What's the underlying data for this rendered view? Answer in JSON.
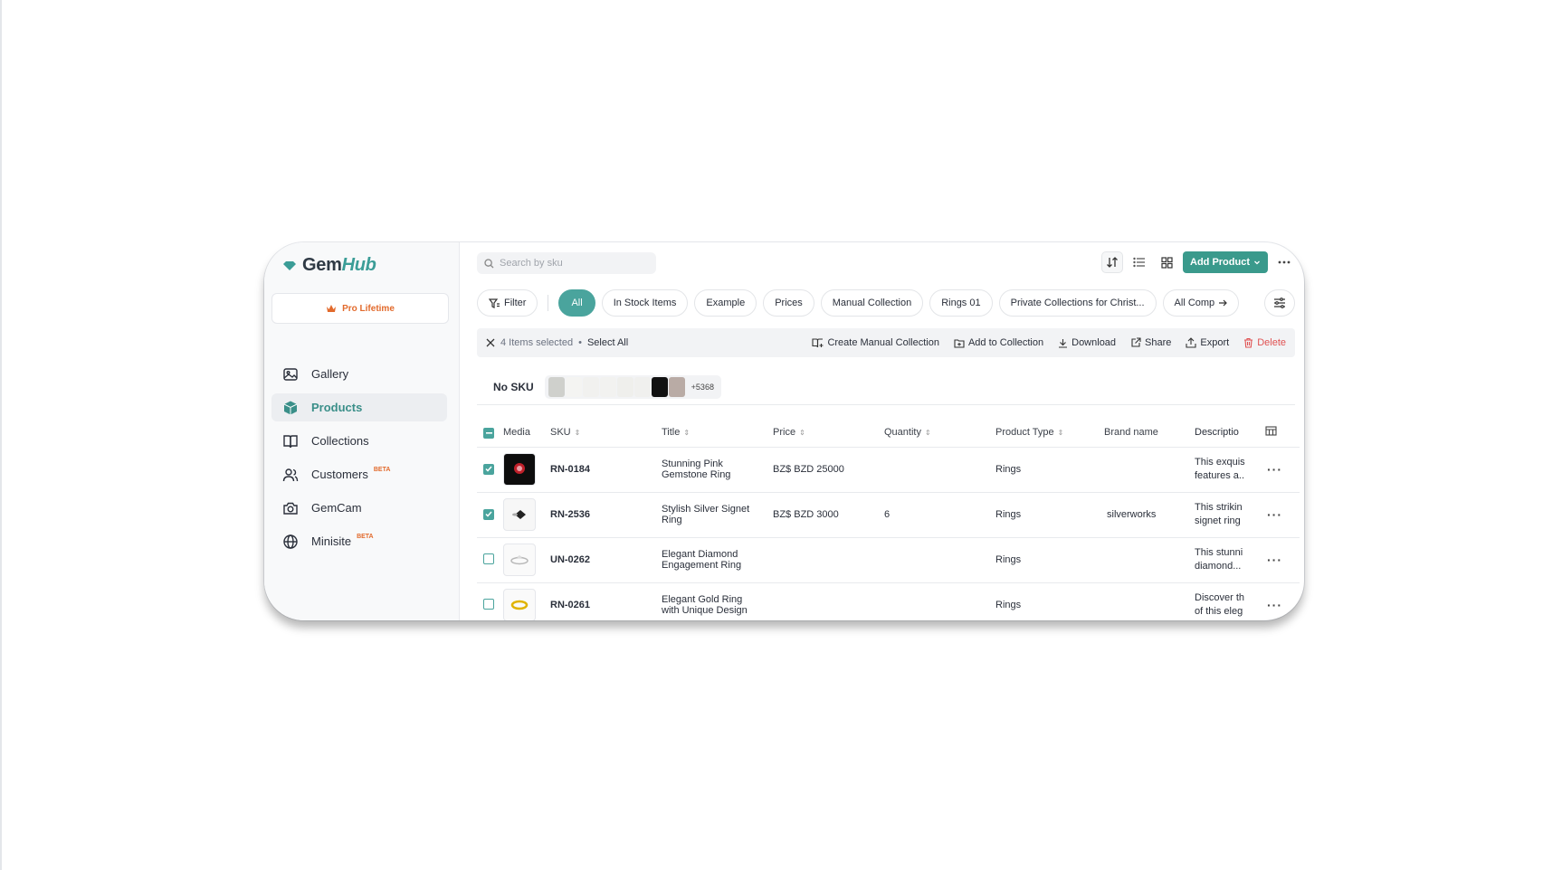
{
  "app": {
    "name_part1": "Gem",
    "name_part2": "Hub"
  },
  "plan": {
    "label": "Pro Lifetime"
  },
  "sidebar": {
    "items": [
      {
        "label": "Gallery",
        "icon": "image-icon"
      },
      {
        "label": "Products",
        "icon": "cube-icon",
        "active": true
      },
      {
        "label": "Collections",
        "icon": "book-icon"
      },
      {
        "label": "Customers",
        "icon": "users-icon",
        "badge": "BETA"
      },
      {
        "label": "GemCam",
        "icon": "camera-icon"
      },
      {
        "label": "Minisite",
        "icon": "globe-icon",
        "badge": "BETA"
      }
    ]
  },
  "search": {
    "placeholder": "Search by sku"
  },
  "toolbar": {
    "add_product_label": "Add Product"
  },
  "filter_label": "Filter",
  "tabs": [
    "All",
    "In Stock Items",
    "Example",
    "Prices",
    "Manual Collection",
    "Rings 01",
    "Private Collections for Christ...",
    "All Comp"
  ],
  "selection": {
    "count_text": "4 Items selected",
    "select_all": "Select All",
    "actions": {
      "create_manual_collection": "Create Manual Collection",
      "add_to_collection": "Add to Collection",
      "download": "Download",
      "share": "Share",
      "export": "Export",
      "delete": "Delete"
    }
  },
  "nosku": {
    "label": "No SKU",
    "more_count": "+5368"
  },
  "table": {
    "headers": {
      "media": "Media",
      "sku": "SKU",
      "title": "Title",
      "price": "Price",
      "quantity": "Quantity",
      "product_type": "Product Type",
      "brand": "Brand name",
      "description": "Descriptio"
    },
    "rows": [
      {
        "checked": true,
        "sku": "RN-0184",
        "title_1": "Stunning Pink",
        "title_2": "Gemstone Ring",
        "price": "BZ$ BZD 25000",
        "quantity": "",
        "type": "Rings",
        "brand": "",
        "desc_1": "This exquis",
        "desc_2": "features a..."
      },
      {
        "checked": true,
        "sku": "RN-2536",
        "title_1": "Stylish Silver Signet",
        "title_2": "Ring",
        "price": "BZ$ BZD 3000",
        "quantity": "6",
        "type": "Rings",
        "brand": "silverworks",
        "desc_1": "This strikin",
        "desc_2": "signet ring"
      },
      {
        "checked": false,
        "sku": "UN-0262",
        "title_1": "Elegant Diamond",
        "title_2": "Engagement Ring",
        "price": "",
        "quantity": "",
        "type": "Rings",
        "brand": "",
        "desc_1": "This stunni",
        "desc_2": "diamond..."
      },
      {
        "checked": false,
        "sku": "RN-0261",
        "title_1": "Elegant Gold Ring",
        "title_2": "with Unique Design",
        "price": "",
        "quantity": "",
        "type": "Rings",
        "brand": "",
        "desc_1": "Discover th",
        "desc_2": "of this eleg"
      }
    ]
  },
  "colors": {
    "accent": "#3a9a8c",
    "delete": "#e05252",
    "pro": "#e26a2c"
  }
}
